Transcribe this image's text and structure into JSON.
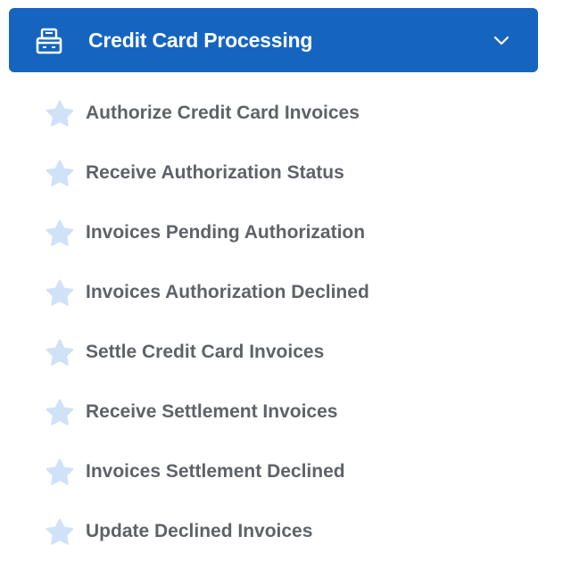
{
  "menu": {
    "title": "Credit Card Processing",
    "title_icon": "register-icon",
    "toggle_icon": "chevron-down-icon",
    "colors": {
      "header_background": "#1565c0",
      "header_text": "#ffffff",
      "item_text": "#5f6368",
      "star_fill": "#cfe2f7"
    },
    "items": [
      {
        "label": "Authorize Credit Card Invoices",
        "icon": "star-icon"
      },
      {
        "label": "Receive Authorization Status",
        "icon": "star-icon"
      },
      {
        "label": "Invoices Pending Authorization",
        "icon": "star-icon"
      },
      {
        "label": "Invoices Authorization Declined",
        "icon": "star-icon"
      },
      {
        "label": "Settle Credit Card Invoices",
        "icon": "star-icon"
      },
      {
        "label": "Receive Settlement Invoices",
        "icon": "star-icon"
      },
      {
        "label": "Invoices Settlement Declined",
        "icon": "star-icon"
      },
      {
        "label": "Update Declined Invoices",
        "icon": "star-icon"
      }
    ]
  }
}
